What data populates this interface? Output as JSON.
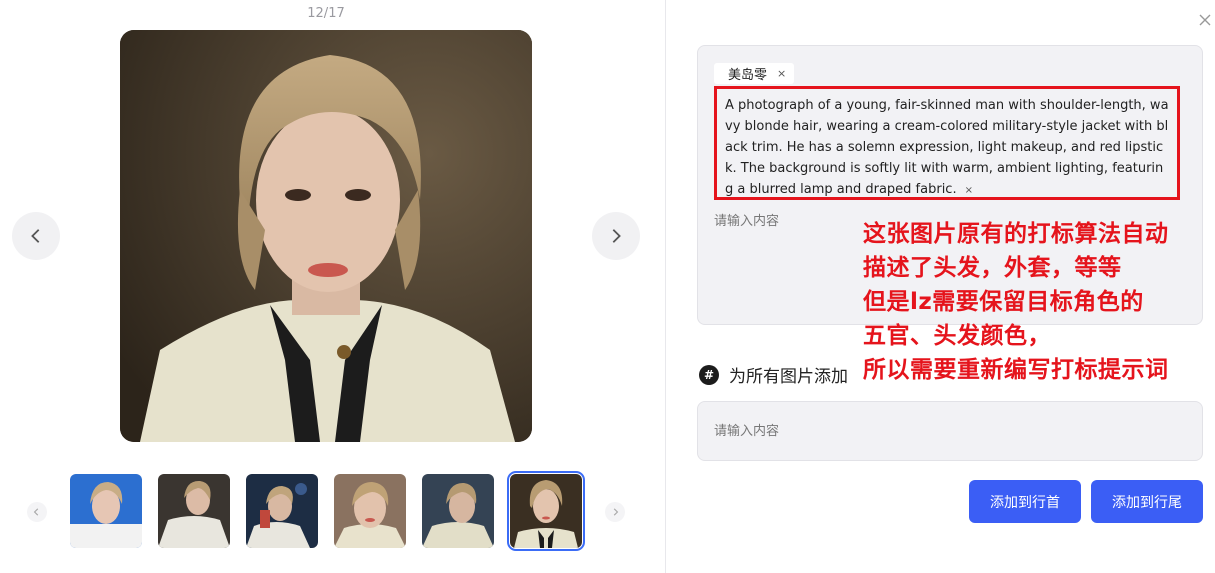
{
  "viewer": {
    "counter": "12/17"
  },
  "editor": {
    "tag_label": "美岛零",
    "tag_remove": "×",
    "caption_text": " A photograph of a young, fair-skinned man with shoulder-length, wavy blonde hair, wearing a cream-colored military-style jacket with black trim. He has a solemn expression, light makeup, and red lipstick. The background is softly lit with warm, ambient lighting, featuring a blurred lamp and draped fabric.",
    "caption_remove": "×",
    "caption_placeholder": "请输入内容",
    "add_all_icon": "#",
    "add_all_label": "为所有图片添加",
    "add_all_placeholder": "请输入内容",
    "btn_add_start": "添加到行首",
    "btn_add_end": "添加到行尾"
  },
  "annotation": {
    "lines": [
      "这张图片原有的打标算法自动",
      "描述了头发，外套，等等",
      "但是lz需要保留目标角色的",
      "五官、头发颜色，",
      "所以需要重新编写打标提示词"
    ]
  },
  "colors": {
    "accent": "#3b5ef5",
    "annotation_red": "#e5141c"
  }
}
